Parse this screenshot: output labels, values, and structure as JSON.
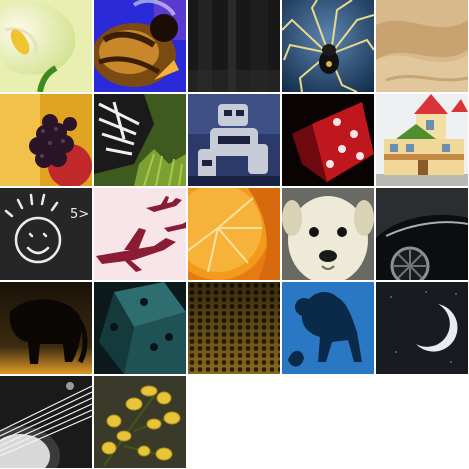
{
  "gallery": {
    "tiles": [
      {
        "subject": "calla-lily"
      },
      {
        "subject": "bee"
      },
      {
        "subject": "dark-texture"
      },
      {
        "subject": "spider"
      },
      {
        "subject": "sand-dunes"
      },
      {
        "subject": "blackberries"
      },
      {
        "subject": "butterfly"
      },
      {
        "subject": "robot"
      },
      {
        "subject": "red-dice"
      },
      {
        "subject": "toy-house"
      },
      {
        "subject": "chalk-face-drawing",
        "text": "5>"
      },
      {
        "subject": "airplanes"
      },
      {
        "subject": "orange-slice"
      },
      {
        "subject": "puppy"
      },
      {
        "subject": "black-car"
      },
      {
        "subject": "elephant-silhouette"
      },
      {
        "subject": "teal-dice"
      },
      {
        "subject": "honeycomb"
      },
      {
        "subject": "monkey-silhouette"
      },
      {
        "subject": "crescent-moon"
      },
      {
        "subject": "guitar-strings"
      },
      {
        "subject": "yellow-flowers"
      }
    ]
  }
}
